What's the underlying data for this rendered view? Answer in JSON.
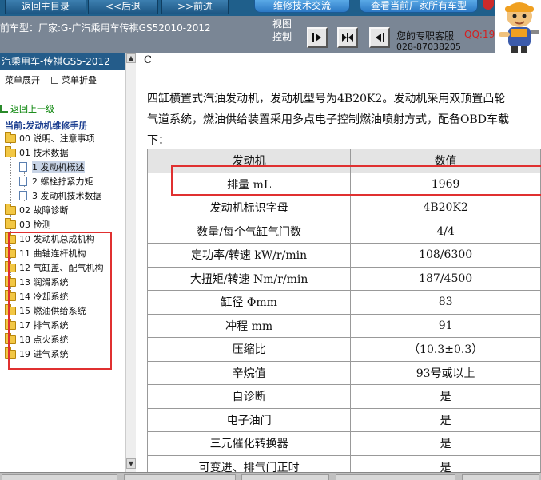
{
  "top_nav": {
    "back_to_main": "返回主目录",
    "back": "<<后退",
    "forward": ">>前进",
    "tech_exchange": "维修技术交流",
    "queue_view": "查看当前厂家所有车型",
    "accent_color": "#1f5f8b"
  },
  "info_bar": {
    "vehicle_model": "前车型：厂家:G-广汽乘用车传祺GS52010-2012",
    "view_control": "视图控制",
    "ctrl_icons": [
      "panel-right-icon",
      "panel-split-icon",
      "panel-left-icon"
    ],
    "customer_service": "您的专职客服",
    "qq_label": "QQ:19",
    "phone": "028-87038205"
  },
  "sidebar": {
    "header": "汽乘用车-传祺GS5-2012",
    "expand_menu": "菜单展开",
    "collapse_menu": "菜单折叠",
    "go_up": "返回上一级",
    "current": "当前:发动机维修手册",
    "items": [
      {
        "label": "00 说明、注意事项",
        "type": "folder"
      },
      {
        "label": "01 技术数据",
        "type": "folder"
      },
      {
        "label": "1 发动机概述",
        "type": "doc",
        "selected": true
      },
      {
        "label": "2 螺栓拧紧力矩",
        "type": "doc"
      },
      {
        "label": "3 发动机技术数据",
        "type": "doc"
      },
      {
        "label": "02 故障诊断",
        "type": "folder"
      },
      {
        "label": "03 检测",
        "type": "folder"
      },
      {
        "label": "10 发动机总成机构",
        "type": "folder"
      },
      {
        "label": "11 曲轴连杆机构",
        "type": "folder"
      },
      {
        "label": "12 气缸盖、配气机构",
        "type": "folder"
      },
      {
        "label": "13 润滑系统",
        "type": "folder"
      },
      {
        "label": "14 冷却系统",
        "type": "folder"
      },
      {
        "label": "15 燃油供给系统",
        "type": "folder"
      },
      {
        "label": "17 排气系统",
        "type": "folder"
      },
      {
        "label": "18 点火系统",
        "type": "folder"
      },
      {
        "label": "19 进气系统",
        "type": "folder"
      }
    ]
  },
  "content": {
    "edge_char": "C",
    "paragraph": [
      "四缸横置式汽油发动机，发动机型号为4B20K2。发动机采用双顶置凸轮",
      "气道系统，燃油供给装置采用多点电子控制燃油喷射方式，配备OBD车载",
      "下："
    ],
    "table": {
      "header": [
        "发动机",
        "数值"
      ],
      "rows": [
        [
          "排量 mL",
          "1969"
        ],
        [
          "发动机标识字母",
          "4B20K2"
        ],
        [
          "数量/每个气缸气门数",
          "4/4"
        ],
        [
          "定功率/转速 kW/r/min",
          "108/6300"
        ],
        [
          "大扭矩/转速 Nm/r/min",
          "187/4500"
        ],
        [
          "缸径 Φmm",
          "83"
        ],
        [
          "冲程 mm",
          "91"
        ],
        [
          "压缩比",
          "（10.3±0.3）"
        ],
        [
          "辛烷值",
          "93号或以上"
        ],
        [
          "自诊断",
          "是"
        ],
        [
          "电子油门",
          "是"
        ],
        [
          "三元催化转换器",
          "是"
        ],
        [
          "可变进、排气门正时",
          "是"
        ]
      ]
    },
    "highlight_color": "#e03030"
  }
}
